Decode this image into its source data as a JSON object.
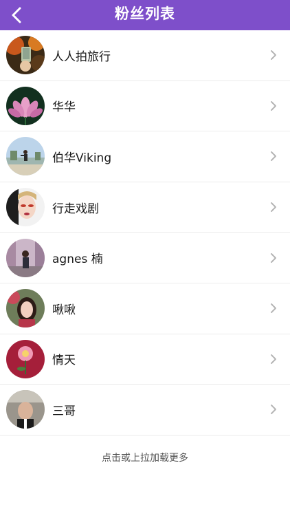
{
  "header": {
    "title": "粉丝列表",
    "back_icon": "chevron-left-icon",
    "background": "#7e4fca"
  },
  "fans": [
    {
      "name": "人人拍旅行",
      "avatar": "avatar-forest-photo"
    },
    {
      "name": "华华",
      "avatar": "avatar-lotus-flower"
    },
    {
      "name": "伯华Viking",
      "avatar": "avatar-beach-person"
    },
    {
      "name": "行走戏剧",
      "avatar": "avatar-opera-face"
    },
    {
      "name": "agnes 楠",
      "avatar": "avatar-street-person"
    },
    {
      "name": "啾啾",
      "avatar": "avatar-girl-portrait"
    },
    {
      "name": "情天",
      "avatar": "avatar-pink-flower"
    },
    {
      "name": "三哥",
      "avatar": "avatar-man-selfie"
    }
  ],
  "load_more": "点击或上拉加载更多",
  "row_chevron_icon": "chevron-right-icon"
}
